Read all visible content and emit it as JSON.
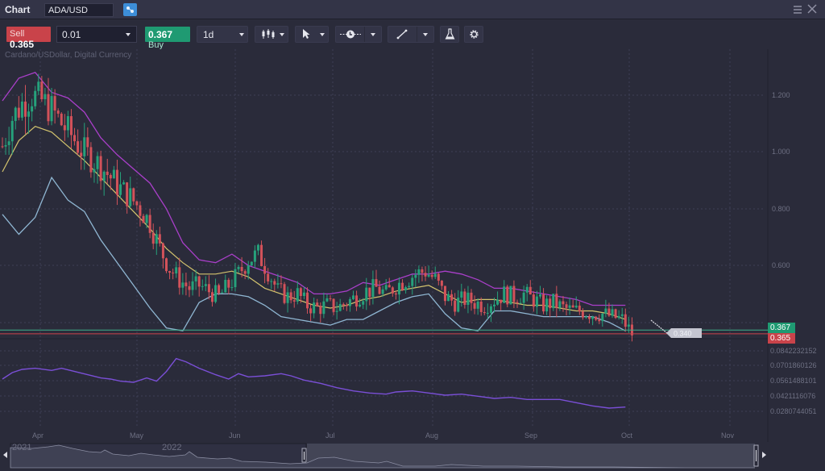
{
  "window": {
    "title": "Chart",
    "symbol": "ADA/USD",
    "link_icon": "link-icon",
    "menu_icon": "hamburger-menu-icon",
    "close_icon": "close-icon"
  },
  "toolbar": {
    "sell_label": "Sell",
    "sell_price": "0.365",
    "quantity": "0.01",
    "buy_price": "0.367",
    "buy_label": "Buy",
    "timeframe": "1d",
    "chart_type_icon": "candlestick-icon",
    "cursor_icon": "cursor-arrow-icon",
    "time_icon": "clock-line-icon",
    "draw_icon": "trend-line-icon",
    "studies_icon": "flask-icon",
    "settings_icon": "gear-icon"
  },
  "chart": {
    "subtitle": "Cardano/USDollar, Digital Currency",
    "colors": {
      "up": "#26a17b",
      "down": "#d2525a",
      "upper_band": "#a93fc9",
      "middle_band": "#d4c46e",
      "lower_band": "#8fb6d2",
      "indicator": "#7a4fd6",
      "bid_line": "#c9434a",
      "ask_line": "#3fae8a"
    },
    "ask_tag": "0.367",
    "bid_tag": "0.365",
    "cursor_tag": "0.340",
    "nav_years": [
      "2021",
      "2022"
    ]
  },
  "chart_data": {
    "type": "candlestick",
    "title": "Cardano/USDollar, Digital Currency",
    "x_ticks": [
      "Apr",
      "May",
      "Jun",
      "Jul",
      "Aug",
      "Sep",
      "Oct",
      "Nov"
    ],
    "price_axis": {
      "ticks": [
        "1.200",
        "1.000",
        "0.800",
        "0.600"
      ],
      "ylim": [
        0.34,
        1.3
      ]
    },
    "indicator_axis": {
      "ticks": [
        "0.0842232152",
        "0.0701860126",
        "0.0561488101",
        "0.0421116076",
        "0.0280744051"
      ],
      "ylim": [
        0.02,
        0.09
      ]
    },
    "price_path": [
      [
        0,
        1.02
      ],
      [
        3,
        1.12
      ],
      [
        6,
        1.17
      ],
      [
        9,
        1.2
      ],
      [
        12,
        1.18
      ],
      [
        15,
        1.15
      ],
      [
        18,
        1.1
      ],
      [
        21,
        1.06
      ],
      [
        24,
        1.01
      ],
      [
        27,
        0.98
      ],
      [
        30,
        0.95
      ],
      [
        33,
        0.91
      ],
      [
        36,
        0.87
      ],
      [
        39,
        0.84
      ],
      [
        42,
        0.8
      ],
      [
        45,
        0.75
      ],
      [
        48,
        0.66
      ],
      [
        51,
        0.59
      ],
      [
        54,
        0.55
      ],
      [
        57,
        0.52
      ],
      [
        60,
        0.53
      ],
      [
        63,
        0.51
      ],
      [
        66,
        0.49
      ],
      [
        69,
        0.53
      ],
      [
        72,
        0.57
      ],
      [
        75,
        0.62
      ],
      [
        78,
        0.64
      ],
      [
        81,
        0.58
      ],
      [
        84,
        0.51
      ],
      [
        87,
        0.49
      ],
      [
        90,
        0.5
      ],
      [
        93,
        0.46
      ],
      [
        96,
        0.45
      ],
      [
        99,
        0.46
      ],
      [
        102,
        0.45
      ],
      [
        105,
        0.47
      ],
      [
        108,
        0.49
      ],
      [
        111,
        0.51
      ],
      [
        114,
        0.52
      ],
      [
        117,
        0.5
      ],
      [
        120,
        0.53
      ],
      [
        123,
        0.55
      ],
      [
        126,
        0.57
      ],
      [
        129,
        0.58
      ],
      [
        132,
        0.55
      ],
      [
        135,
        0.49
      ],
      [
        138,
        0.47
      ],
      [
        141,
        0.48
      ],
      [
        144,
        0.47
      ],
      [
        147,
        0.46
      ],
      [
        150,
        0.48
      ],
      [
        153,
        0.5
      ],
      [
        156,
        0.49
      ],
      [
        159,
        0.5
      ],
      [
        162,
        0.48
      ],
      [
        165,
        0.46
      ],
      [
        168,
        0.47
      ],
      [
        171,
        0.45
      ],
      [
        174,
        0.44
      ],
      [
        177,
        0.44
      ],
      [
        180,
        0.43
      ],
      [
        183,
        0.43
      ],
      [
        186,
        0.42
      ],
      [
        189,
        0.41
      ],
      [
        192,
        0.36
      ]
    ],
    "bollinger": {
      "upper": [
        [
          0,
          1.18
        ],
        [
          5,
          1.26
        ],
        [
          10,
          1.28
        ],
        [
          15,
          1.21
        ],
        [
          20,
          1.19
        ],
        [
          25,
          1.14
        ],
        [
          30,
          1.05
        ],
        [
          35,
          0.99
        ],
        [
          40,
          0.94
        ],
        [
          45,
          0.89
        ],
        [
          50,
          0.8
        ],
        [
          55,
          0.68
        ],
        [
          60,
          0.62
        ],
        [
          65,
          0.61
        ],
        [
          70,
          0.64
        ],
        [
          75,
          0.6
        ],
        [
          80,
          0.58
        ],
        [
          85,
          0.56
        ],
        [
          90,
          0.54
        ],
        [
          95,
          0.5
        ],
        [
          100,
          0.5
        ],
        [
          105,
          0.51
        ],
        [
          110,
          0.54
        ],
        [
          115,
          0.53
        ],
        [
          120,
          0.55
        ],
        [
          125,
          0.57
        ],
        [
          130,
          0.57
        ],
        [
          135,
          0.58
        ],
        [
          140,
          0.57
        ],
        [
          145,
          0.55
        ],
        [
          150,
          0.52
        ],
        [
          155,
          0.52
        ],
        [
          160,
          0.51
        ],
        [
          165,
          0.5
        ],
        [
          170,
          0.49
        ],
        [
          175,
          0.48
        ],
        [
          180,
          0.46
        ],
        [
          185,
          0.46
        ],
        [
          190,
          0.46
        ]
      ],
      "middle": [
        [
          0,
          0.93
        ],
        [
          5,
          1.04
        ],
        [
          10,
          1.09
        ],
        [
          15,
          1.07
        ],
        [
          20,
          1.02
        ],
        [
          25,
          0.97
        ],
        [
          30,
          0.91
        ],
        [
          35,
          0.85
        ],
        [
          40,
          0.79
        ],
        [
          45,
          0.73
        ],
        [
          50,
          0.66
        ],
        [
          55,
          0.61
        ],
        [
          60,
          0.57
        ],
        [
          65,
          0.57
        ],
        [
          70,
          0.58
        ],
        [
          75,
          0.56
        ],
        [
          80,
          0.52
        ],
        [
          85,
          0.5
        ],
        [
          90,
          0.48
        ],
        [
          95,
          0.46
        ],
        [
          100,
          0.45
        ],
        [
          105,
          0.46
        ],
        [
          110,
          0.48
        ],
        [
          115,
          0.49
        ],
        [
          120,
          0.51
        ],
        [
          125,
          0.52
        ],
        [
          130,
          0.53
        ],
        [
          135,
          0.5
        ],
        [
          140,
          0.47
        ],
        [
          145,
          0.48
        ],
        [
          150,
          0.48
        ],
        [
          155,
          0.47
        ],
        [
          160,
          0.46
        ],
        [
          165,
          0.46
        ],
        [
          170,
          0.45
        ],
        [
          175,
          0.44
        ],
        [
          180,
          0.44
        ],
        [
          185,
          0.43
        ],
        [
          190,
          0.41
        ]
      ],
      "lower": [
        [
          0,
          0.78
        ],
        [
          5,
          0.71
        ],
        [
          10,
          0.77
        ],
        [
          15,
          0.91
        ],
        [
          20,
          0.83
        ],
        [
          25,
          0.79
        ],
        [
          30,
          0.69
        ],
        [
          35,
          0.61
        ],
        [
          40,
          0.53
        ],
        [
          45,
          0.45
        ],
        [
          50,
          0.38
        ],
        [
          55,
          0.37
        ],
        [
          60,
          0.47
        ],
        [
          65,
          0.5
        ],
        [
          70,
          0.5
        ],
        [
          75,
          0.49
        ],
        [
          80,
          0.46
        ],
        [
          85,
          0.42
        ],
        [
          90,
          0.41
        ],
        [
          95,
          0.4
        ],
        [
          100,
          0.39
        ],
        [
          105,
          0.41
        ],
        [
          110,
          0.41
        ],
        [
          115,
          0.44
        ],
        [
          120,
          0.47
        ],
        [
          125,
          0.49
        ],
        [
          130,
          0.5
        ],
        [
          135,
          0.43
        ],
        [
          140,
          0.38
        ],
        [
          145,
          0.37
        ],
        [
          150,
          0.44
        ],
        [
          155,
          0.44
        ],
        [
          160,
          0.43
        ],
        [
          165,
          0.42
        ],
        [
          170,
          0.42
        ],
        [
          175,
          0.42
        ],
        [
          180,
          0.42
        ],
        [
          185,
          0.4
        ],
        [
          190,
          0.37
        ]
      ]
    },
    "indicator": [
      [
        0,
        0.058
      ],
      [
        3,
        0.064
      ],
      [
        6,
        0.067
      ],
      [
        10,
        0.068
      ],
      [
        15,
        0.066
      ],
      [
        18,
        0.068
      ],
      [
        22,
        0.065
      ],
      [
        26,
        0.062
      ],
      [
        30,
        0.059
      ],
      [
        33,
        0.058
      ],
      [
        36,
        0.056
      ],
      [
        40,
        0.055
      ],
      [
        44,
        0.059
      ],
      [
        47,
        0.056
      ],
      [
        50,
        0.065
      ],
      [
        53,
        0.077
      ],
      [
        56,
        0.074
      ],
      [
        60,
        0.068
      ],
      [
        65,
        0.062
      ],
      [
        69,
        0.058
      ],
      [
        72,
        0.063
      ],
      [
        75,
        0.06
      ],
      [
        80,
        0.061
      ],
      [
        85,
        0.063
      ],
      [
        88,
        0.061
      ],
      [
        92,
        0.057
      ],
      [
        97,
        0.054
      ],
      [
        102,
        0.05
      ],
      [
        107,
        0.047
      ],
      [
        112,
        0.045
      ],
      [
        117,
        0.044
      ],
      [
        120,
        0.046
      ],
      [
        125,
        0.047
      ],
      [
        130,
        0.045
      ],
      [
        135,
        0.043
      ],
      [
        140,
        0.044
      ],
      [
        145,
        0.042
      ],
      [
        150,
        0.04
      ],
      [
        155,
        0.041
      ],
      [
        160,
        0.039
      ],
      [
        165,
        0.039
      ],
      [
        170,
        0.039
      ],
      [
        175,
        0.036
      ],
      [
        180,
        0.033
      ],
      [
        185,
        0.031
      ],
      [
        190,
        0.032
      ]
    ],
    "bid": 0.365,
    "ask": 0.367
  }
}
